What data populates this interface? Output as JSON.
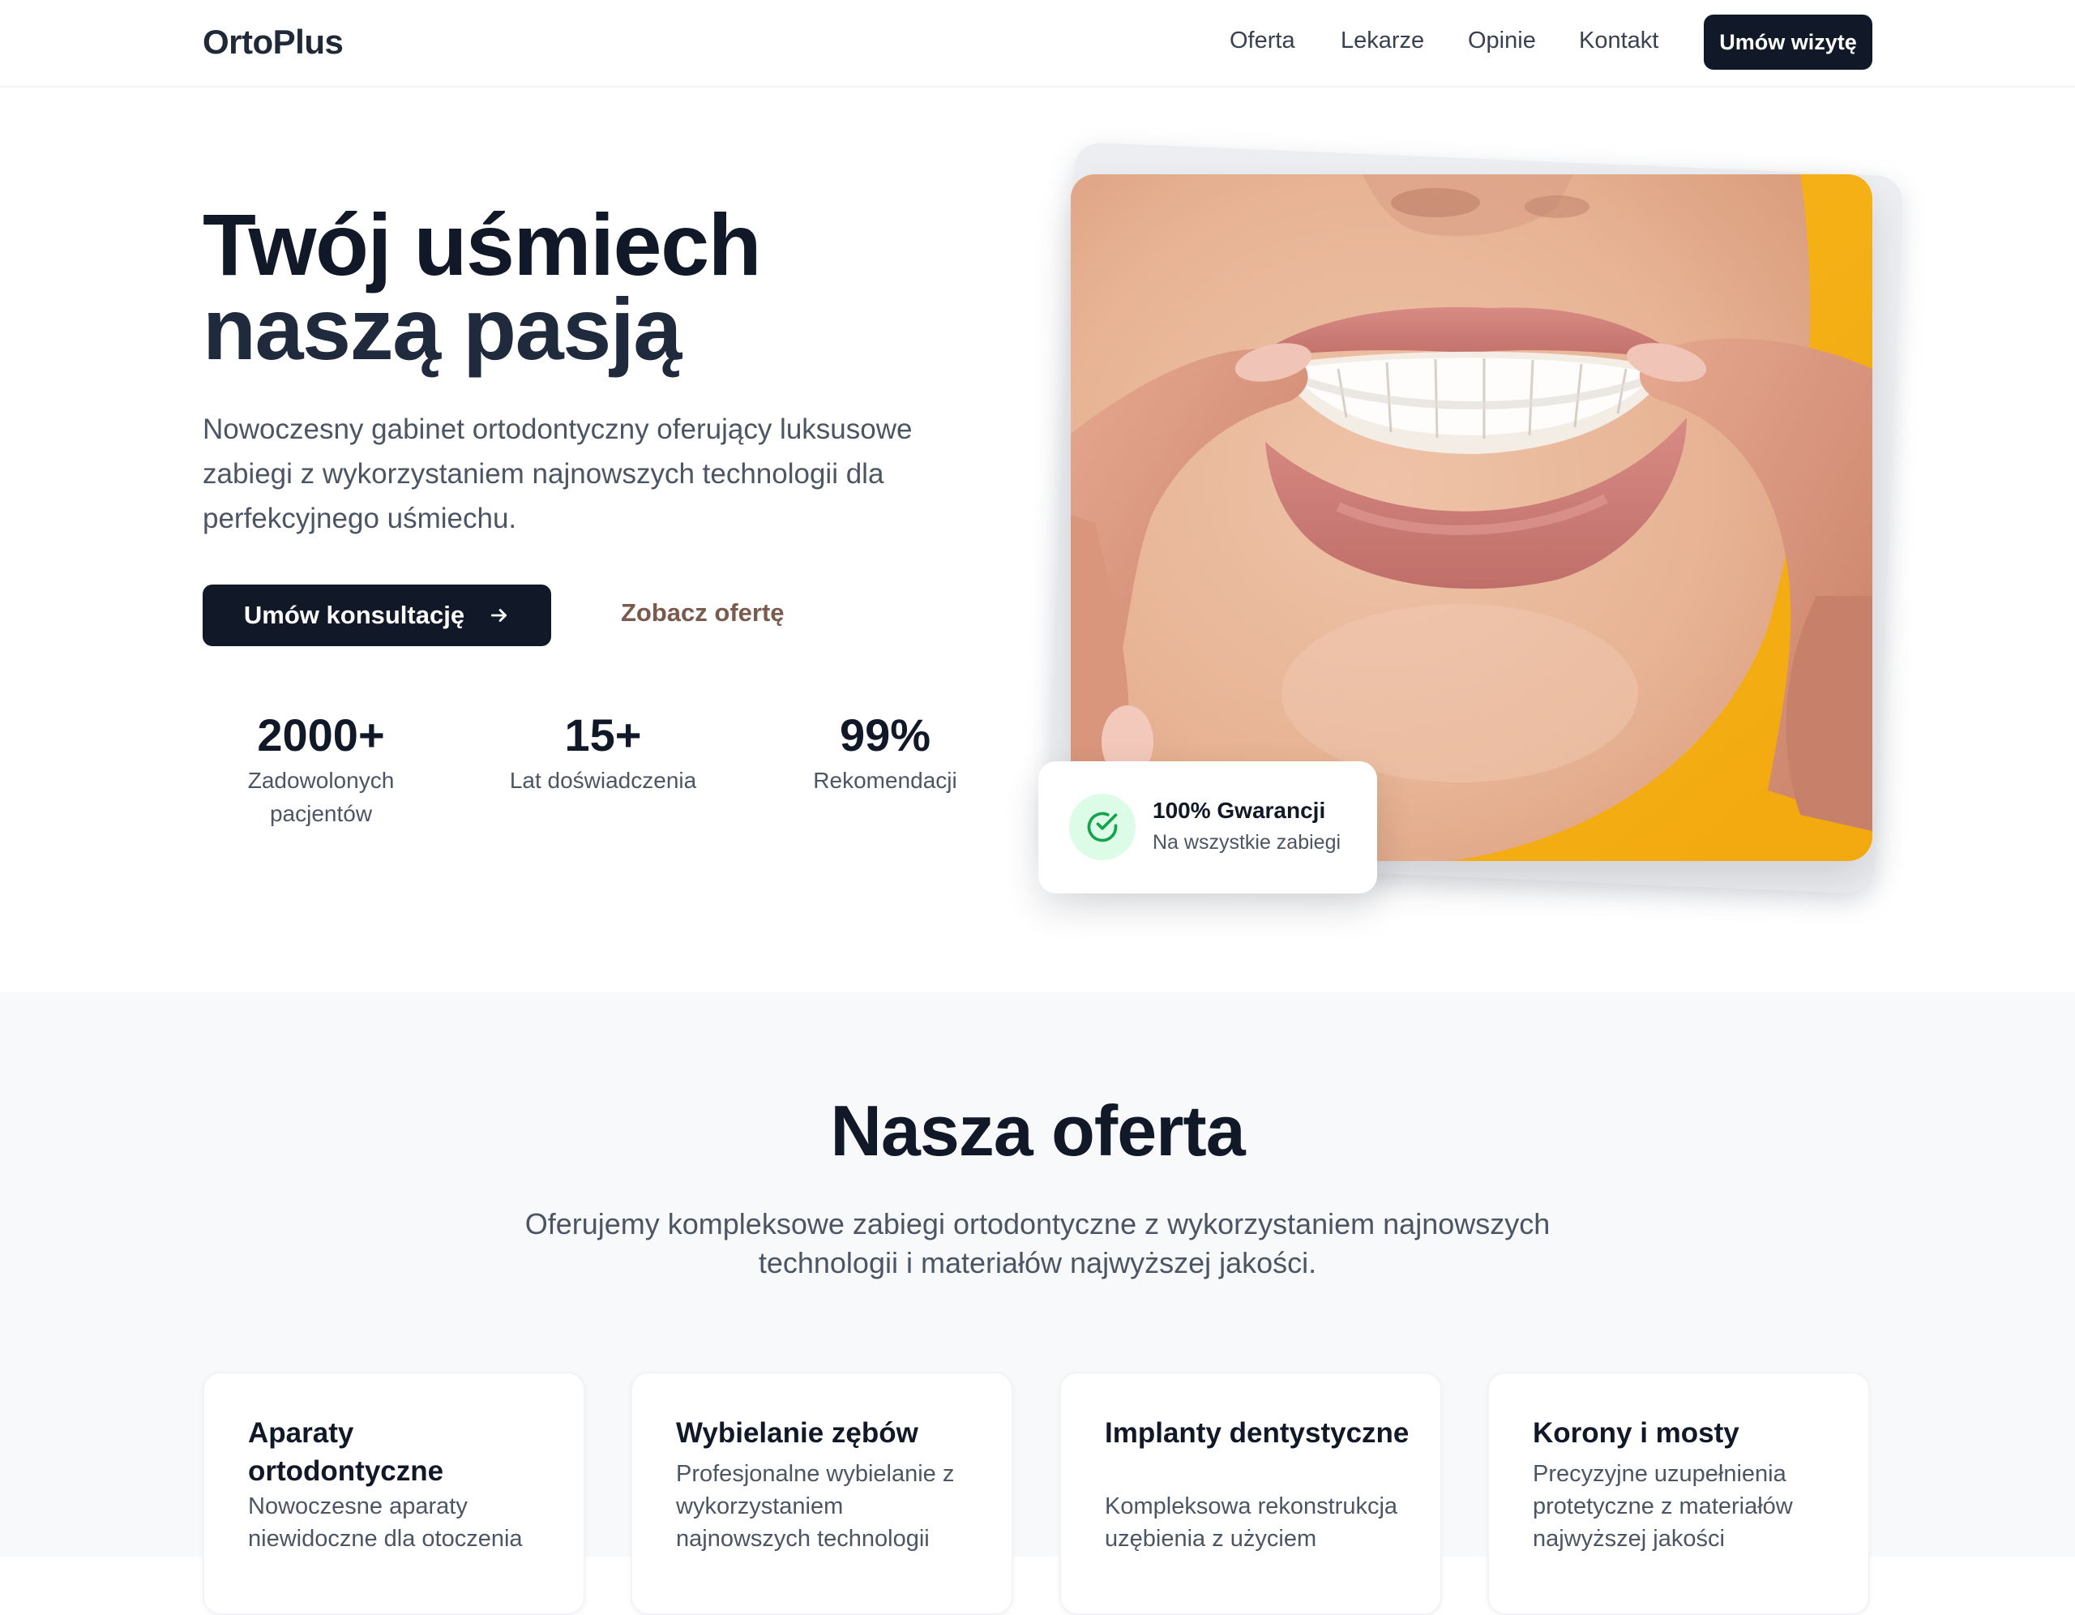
{
  "nav": {
    "logo": "OrtoPlus",
    "links": [
      "Oferta",
      "Lekarze",
      "Opinie",
      "Kontakt"
    ],
    "cta": "Umów wizytę"
  },
  "hero": {
    "title_line1": "Twój uśmiech",
    "title_line2": "naszą pasją",
    "description": "Nowoczesny gabinet ortodontyczny oferujący luksusowe zabiegi z wykorzystaniem najnowszych technologii dla perfekcyjnego uśmiechu.",
    "primary_button": "Umów konsultację",
    "secondary_button": "Zobacz ofertę",
    "stats": [
      {
        "value": "2000+",
        "label": "Zadowolonych pacjentów"
      },
      {
        "value": "15+",
        "label": "Lat doświadczenia"
      },
      {
        "value": "99%",
        "label": "Rekomendacji"
      }
    ],
    "badge": {
      "title": "100% Gwarancji",
      "subtitle": "Na wszystkie zabiegi"
    }
  },
  "offer": {
    "title": "Nasza oferta",
    "description": "Oferujemy kompleksowe zabiegi ortodontyczne z wykorzystaniem najnowszych technologii i materiałów najwyższej jakości.",
    "cards": [
      {
        "title": "Aparaty ortodontyczne",
        "description": "Nowoczesne aparaty niewidoczne dla otoczenia"
      },
      {
        "title": "Wybielanie zębów",
        "description": "Profesjonalne wybielanie z wykorzystaniem najnowszych technologii"
      },
      {
        "title": "Implanty dentystyczne",
        "description": "Kompleksowa rekonstrukcja uzębienia z użyciem"
      },
      {
        "title": "Korony i mosty",
        "description": "Precyzyjne uzupełnienia protetyczne z materiałów najwyższej jakości"
      }
    ]
  },
  "colors": {
    "primary": "#111827",
    "accent_link": "#7a5a4d",
    "badge_green": "#22c55e",
    "image_background": "#f5b21a"
  }
}
